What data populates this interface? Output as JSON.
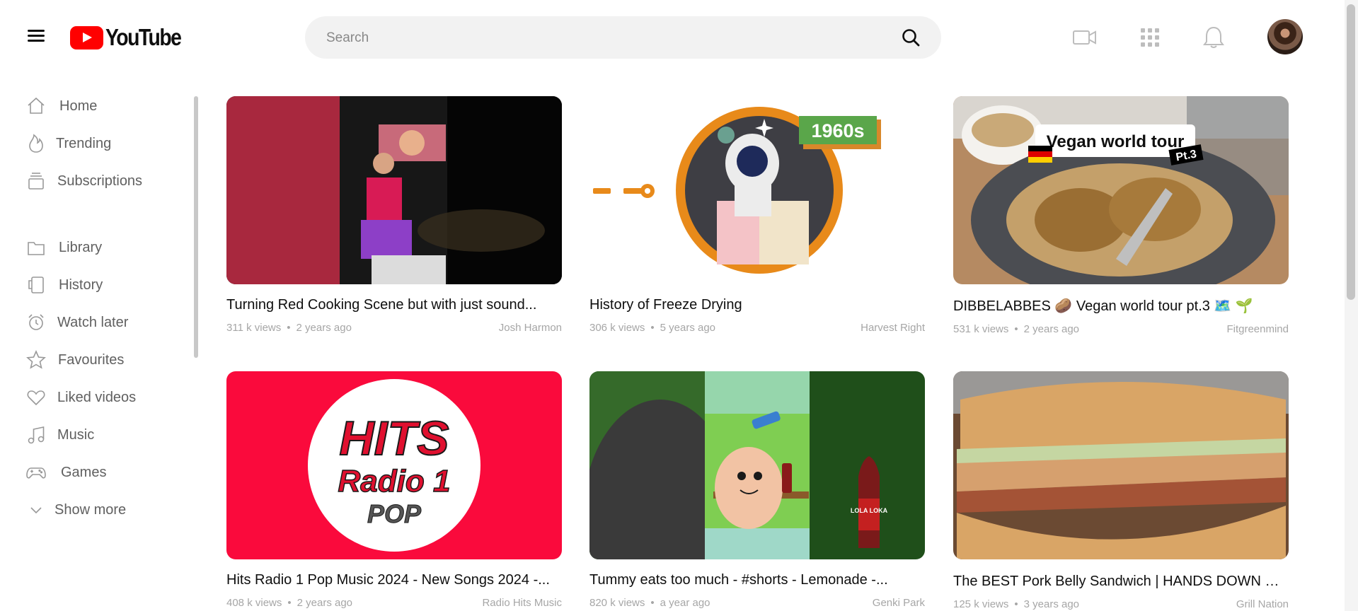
{
  "header": {
    "logo_text": "YouTube",
    "search_placeholder": "Search"
  },
  "sidebar": {
    "items": [
      {
        "label": "Home",
        "icon": "home-icon"
      },
      {
        "label": "Trending",
        "icon": "flame-icon"
      },
      {
        "label": "Subscriptions",
        "icon": "subscriptions-icon"
      },
      {
        "label": "Library",
        "icon": "folder-icon"
      },
      {
        "label": "History",
        "icon": "history-icon"
      },
      {
        "label": "Watch later",
        "icon": "alarm-clock-icon"
      },
      {
        "label": "Favourites",
        "icon": "star-icon"
      },
      {
        "label": "Liked videos",
        "icon": "heart-icon"
      },
      {
        "label": "Music",
        "icon": "music-note-icon"
      },
      {
        "label": "Games",
        "icon": "gamepad-icon"
      },
      {
        "label": "Show more",
        "icon": "chevron-down-icon"
      }
    ]
  },
  "videos": [
    {
      "title": "Turning Red Cooking Scene but with just sound...",
      "views": "311 k views",
      "age": "2 years ago",
      "channel": "Josh Harmon"
    },
    {
      "title": "History of Freeze Drying",
      "views": "306 k views",
      "age": "5 years ago",
      "channel": "Harvest Right",
      "thumb_text": "1960s"
    },
    {
      "title": "DIBBELABBES 🥔 Vegan world tour pt.3 🗺️ 🌱",
      "views": "531 k views",
      "age": "2 years ago",
      "channel": "Fitgreenmind",
      "thumb_text": "Vegan world tour",
      "thumb_sub": "Pt.3"
    },
    {
      "title": "Hits Radio 1 Pop Music 2024 - New Songs 2024 -...",
      "views": "408 k views",
      "age": "2 years ago",
      "channel": "Radio Hits Music",
      "thumb_line1": "HITS",
      "thumb_line2": "Radio 1",
      "thumb_line3": "POP"
    },
    {
      "title": "Tummy eats too much - #shorts - Lemonade -...",
      "views": "820 k views",
      "age": "a year ago",
      "channel": "Genki Park",
      "thumb_text": "LOLA LOKA"
    },
    {
      "title": "The BEST Pork Belly Sandwich | HANDS DOWN 🙌 |",
      "views": "125 k views",
      "age": "3 years ago",
      "channel": "Grill Nation"
    }
  ],
  "colors": {
    "brand": "#ff0000",
    "meta": "#a6a6a6",
    "sidebar_text": "#606060"
  }
}
